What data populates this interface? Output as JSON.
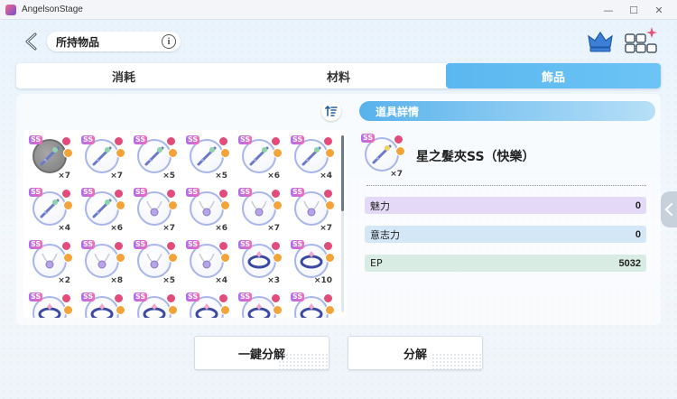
{
  "window": {
    "title": "AngelsonStage"
  },
  "header": {
    "title": "所持物品"
  },
  "tabs": [
    {
      "label": "消耗"
    },
    {
      "label": "材料"
    },
    {
      "label": "飾品"
    }
  ],
  "items": [
    {
      "count": "×7",
      "kind": "hairpin"
    },
    {
      "count": "×7",
      "kind": "hairpin"
    },
    {
      "count": "×5",
      "kind": "hairpin"
    },
    {
      "count": "×5",
      "kind": "hairpin"
    },
    {
      "count": "×6",
      "kind": "hairpin"
    },
    {
      "count": "×4",
      "kind": "hairpin"
    },
    {
      "count": "×4",
      "kind": "hairpin"
    },
    {
      "count": "×6",
      "kind": "hairpin"
    },
    {
      "count": "×7",
      "kind": "necklace"
    },
    {
      "count": "×6",
      "kind": "necklace"
    },
    {
      "count": "×7",
      "kind": "necklace"
    },
    {
      "count": "×7",
      "kind": "necklace"
    },
    {
      "count": "×2",
      "kind": "necklace"
    },
    {
      "count": "×8",
      "kind": "necklace"
    },
    {
      "count": "×5",
      "kind": "necklace"
    },
    {
      "count": "×4",
      "kind": "necklace"
    },
    {
      "count": "×3",
      "kind": "ring"
    },
    {
      "count": "×10",
      "kind": "ring"
    }
  ],
  "detail": {
    "header": "道具詳情",
    "name": "星之髮夾SS（快樂）",
    "count": "×7",
    "stats": [
      {
        "label": "魅力",
        "value": "0"
      },
      {
        "label": "意志力",
        "value": "0"
      },
      {
        "label": "EP",
        "value": "5032"
      }
    ]
  },
  "buttons": {
    "bulk_dismantle": "一鍵分解",
    "dismantle": "分解"
  }
}
